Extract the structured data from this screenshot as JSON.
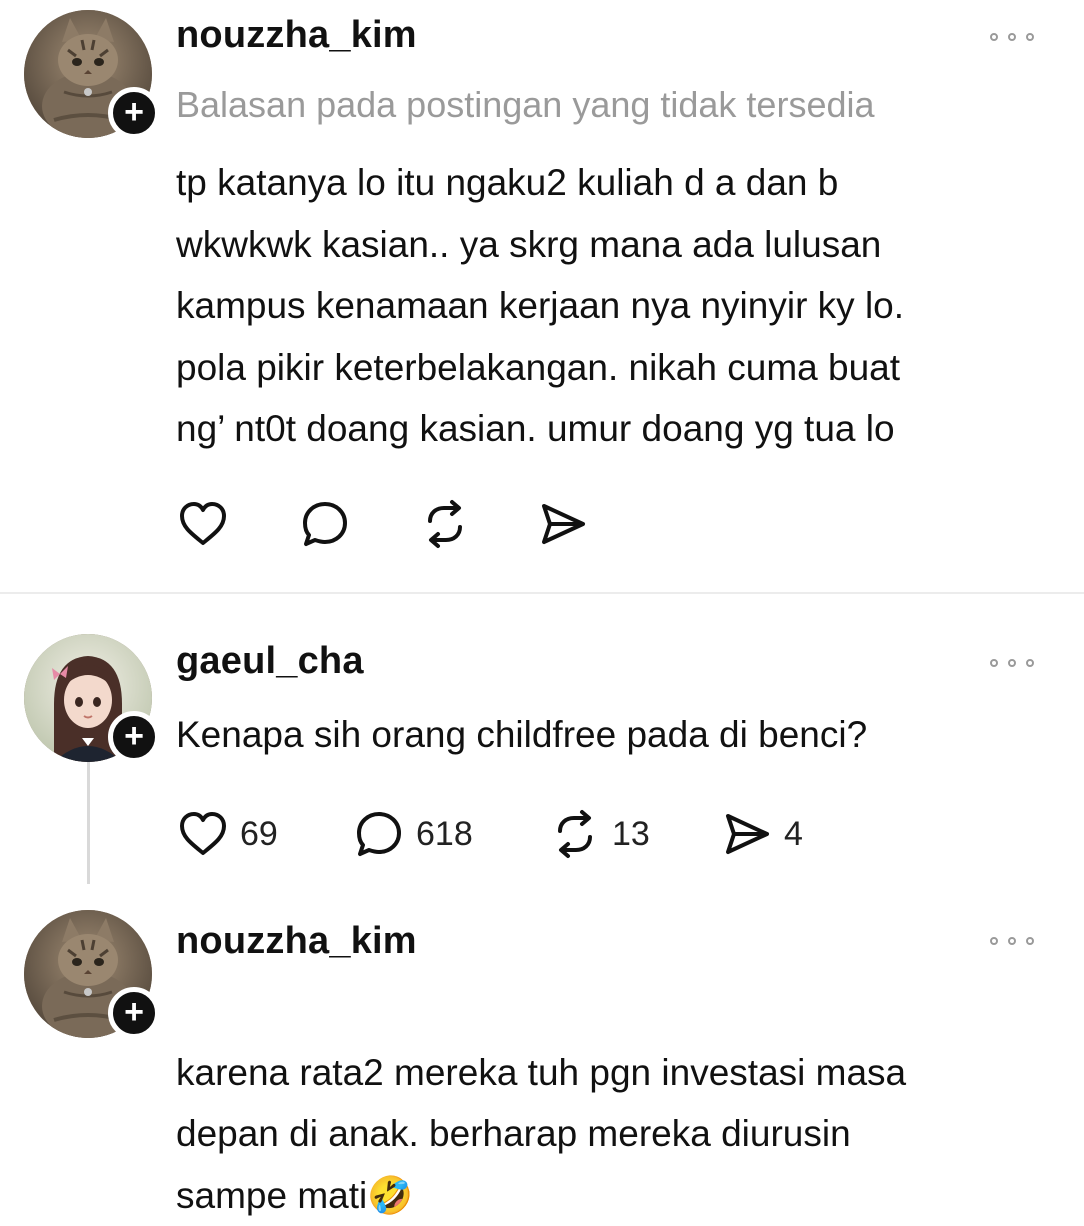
{
  "posts": [
    {
      "username": "nouzzha_kim",
      "reply_note": "Balasan pada postingan yang tidak tersedia",
      "text": "tp katanya lo itu ngaku2 kuliah d a dan b\nwkwkwk kasian.. ya skrg mana ada lulusan\nkampus kenamaan kerjaan nya nyinyir ky lo.\npola pikir keterbelakangan. nikah cuma buat\nng’ nt0t doang kasian. umur doang yg tua lo",
      "follow_symbol": "+",
      "actions": {
        "like_icon": "heart-icon",
        "comment_icon": "comment-bubble-icon",
        "repost_icon": "repost-icon",
        "share_icon": "send-icon"
      }
    },
    {
      "username": "gaeul_cha",
      "text": "Kenapa sih orang childfree pada di benci?",
      "follow_symbol": "+",
      "counts": {
        "likes": "69",
        "comments": "618",
        "reposts": "13",
        "shares": "4"
      }
    },
    {
      "username": "nouzzha_kim",
      "text": "karena rata2 mereka tuh pgn investasi masa\ndepan di anak. berharap mereka diurusin\nsampe mati",
      "emoji": "🤣",
      "follow_symbol": "+"
    }
  ],
  "colors": {
    "text": "#111111",
    "muted": "#9a9a9a",
    "divider": "#ececec",
    "badge": "#111111"
  }
}
